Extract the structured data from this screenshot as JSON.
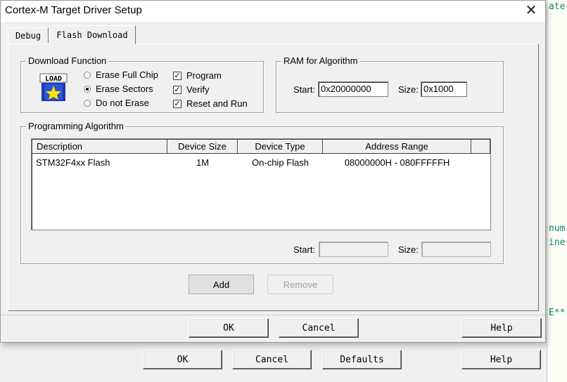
{
  "window": {
    "title": "Cortex-M Target Driver Setup"
  },
  "tabs": [
    {
      "label": "Debug",
      "active": false
    },
    {
      "label": "Flash Download",
      "active": true
    }
  ],
  "download_function": {
    "legend": "Download Function",
    "icon_text": "LOAD",
    "radios": [
      {
        "label": "Erase Full Chip",
        "selected": false
      },
      {
        "label": "Erase Sectors",
        "selected": true
      },
      {
        "label": "Do not Erase",
        "selected": false
      }
    ],
    "checks": [
      {
        "label": "Program",
        "checked": true
      },
      {
        "label": "Verify",
        "checked": true
      },
      {
        "label": "Reset and Run",
        "checked": true
      }
    ]
  },
  "ram_for_algorithm": {
    "legend": "RAM for Algorithm",
    "start_label": "Start:",
    "start_value": "0x20000000",
    "size_label": "Size:",
    "size_value": "0x1000"
  },
  "programming_algorithm": {
    "legend": "Programming Algorithm",
    "columns": [
      "Description",
      "Device Size",
      "Device Type",
      "Address Range"
    ],
    "rows": [
      {
        "description": "STM32F4xx Flash",
        "device_size": "1M",
        "device_type": "On-chip Flash",
        "address_range": "08000000H - 080FFFFFH"
      }
    ],
    "start_label": "Start:",
    "start_value": "",
    "size_label": "Size:",
    "size_value": ""
  },
  "buttons": {
    "add": "Add",
    "remove": "Remove",
    "ok": "OK",
    "cancel": "Cancel",
    "help": "Help"
  },
  "parent_buttons": {
    "ok": "OK",
    "cancel": "Cancel",
    "defaults": "Defaults",
    "help": "Help"
  },
  "background_editor": {
    "fragments": [
      "ate",
      "num",
      "ine",
      "E**"
    ]
  }
}
